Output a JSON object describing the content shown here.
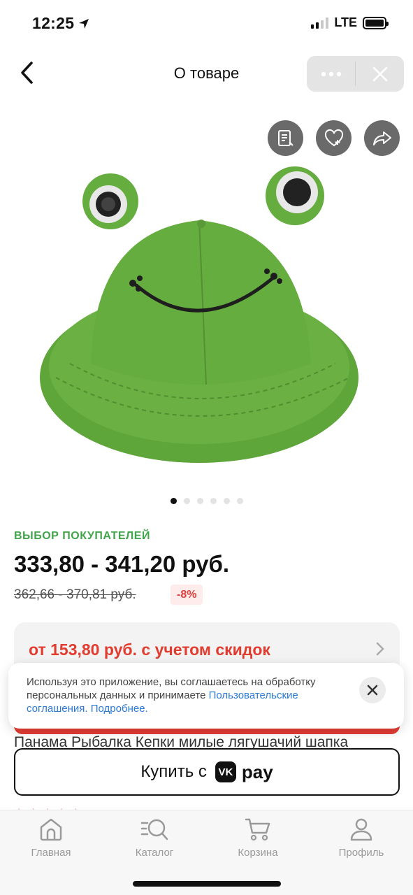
{
  "status_bar": {
    "time": "12:25",
    "network": "LTE"
  },
  "nav": {
    "title": "О товаре"
  },
  "gallery": {
    "total_images": 6,
    "active_index": 0
  },
  "product": {
    "badge": "ВЫБОР ПОКУПАТЕЛЕЙ",
    "price_range": "333,80 - 341,20 руб.",
    "old_price_range": "362,66 - 370,81 руб.",
    "discount": "-8%",
    "promo_text": "от 153,80 руб. с учетом скидок",
    "title": "Панама Рыбалка Кепки милые лягушачий шапка"
  },
  "consent": {
    "text": "Используя это приложение, вы соглашаетесь на обработку персональных данных и принимаете ",
    "link_terms": "Пользовательские соглашения.",
    "link_more": "Подробнее."
  },
  "buy_button": {
    "label": "Купить с",
    "brand_logo": "vk",
    "brand_text": "pay"
  },
  "tabs": [
    {
      "label": "Главная",
      "icon": "home-icon"
    },
    {
      "label": "Каталог",
      "icon": "catalog-search-icon"
    },
    {
      "label": "Корзина",
      "icon": "cart-icon"
    },
    {
      "label": "Профиль",
      "icon": "profile-icon"
    }
  ],
  "colors": {
    "accent_green": "#41a54a",
    "promo_red": "#e23b2f",
    "link_blue": "#2a7ad6"
  }
}
